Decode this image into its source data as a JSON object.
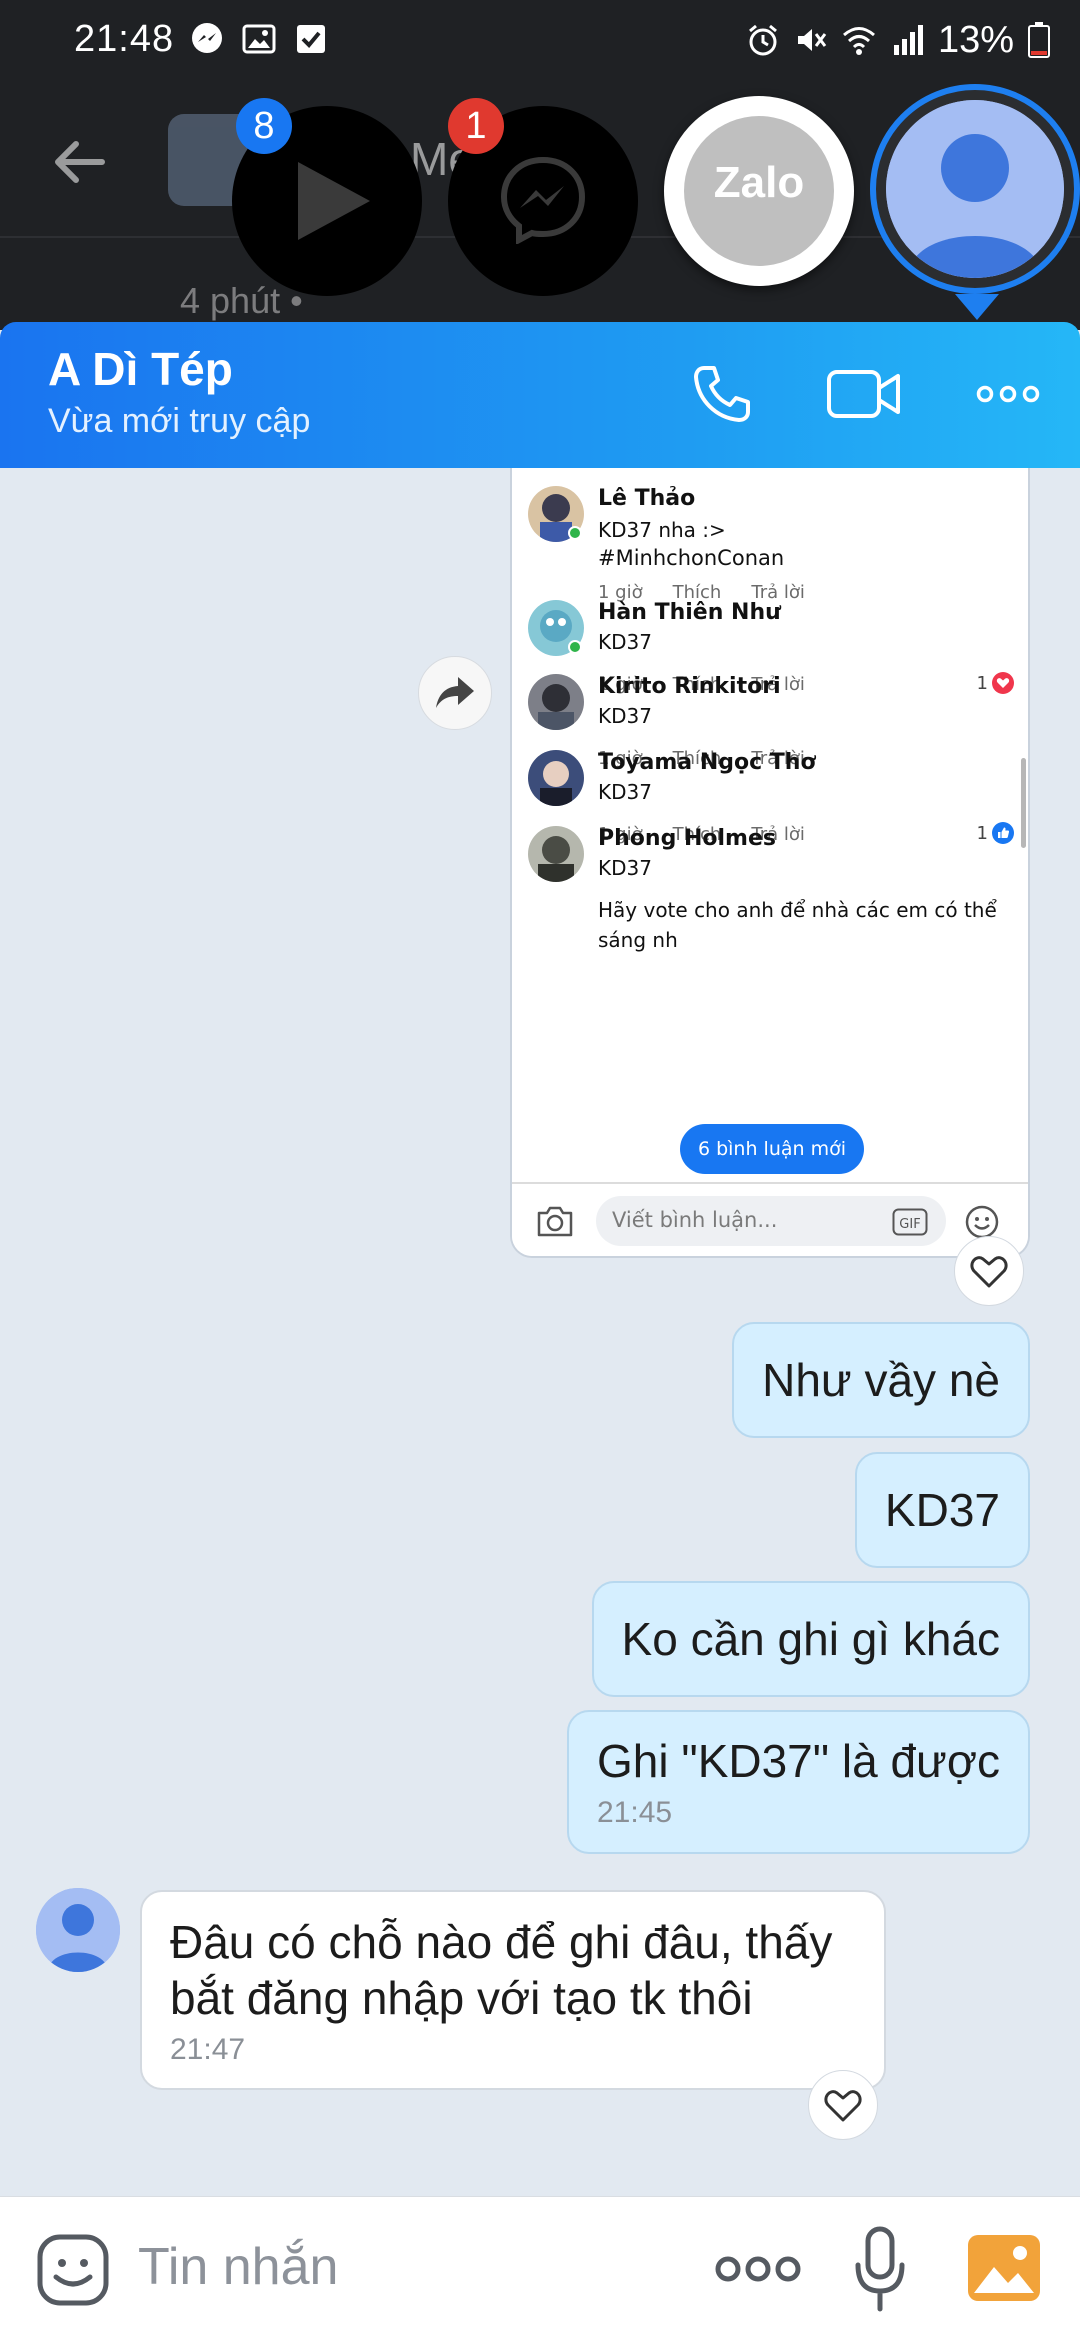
{
  "status_bar": {
    "time": "21:48",
    "battery_percent": "13%",
    "notification_icons": [
      "messenger-icon",
      "image-icon",
      "checkbox-icon"
    ],
    "system_icons": [
      "alarm-icon",
      "mute-icon",
      "wifi-icon",
      "signal-icon",
      "battery-icon"
    ]
  },
  "background_app": {
    "title_fragment": "Me",
    "subtitle_fragment": "4 phút •"
  },
  "floating_heads": {
    "play_badge": "8",
    "messenger_badge": "1",
    "zalo_label": "Zalo"
  },
  "chat_header": {
    "contact_name": "A Dì Tép",
    "presence": "Vừa mới truy cập",
    "accent_start": "#1a74f0",
    "accent_end": "#25b7f7"
  },
  "shared_screenshot": {
    "comments": [
      {
        "name": "Lê Thảo",
        "text": "KD37 nha :>"
      },
      {
        "name": "",
        "text": "#MinhchonConan",
        "meta": [
          "1 giờ",
          "Thích",
          "Trả lời"
        ]
      },
      {
        "name": "Hàn Thiên Như",
        "text": "KD37",
        "meta": [
          "1 giờ",
          "Thích",
          "Trả lời"
        ],
        "reaction_count": "1"
      },
      {
        "name": "Kirito Rinkitori",
        "text": "KD37",
        "meta": [
          "1 giờ",
          "Thích",
          "Trả lời"
        ]
      },
      {
        "name": "Toyama Ngọc Thơ",
        "text": "KD37",
        "meta": [
          "1 giờ",
          "Thích",
          "Trả lời"
        ],
        "reaction_count": "1"
      },
      {
        "name": "Phong Holmes",
        "text": "KD37"
      }
    ],
    "tail_line1": "Hãy vote cho anh để nhà các em có thể",
    "tail_line2": "sáng nh",
    "new_comments_pill": "6 bình luận mới",
    "comment_placeholder": "Viết bình luận..."
  },
  "messages_out": [
    {
      "text": "Như vầy nè"
    },
    {
      "text": "KD37"
    },
    {
      "text": "Ko cần ghi gì khác"
    },
    {
      "text": "Ghi \"KD37\" là được",
      "time": "21:45"
    }
  ],
  "message_in": {
    "line1": "Đâu có chỗ nào để ghi đâu, thấy",
    "line2": "bắt đăng nhập với tạo tk thôi",
    "time": "21:47"
  },
  "composer": {
    "placeholder": "Tin nhắn"
  }
}
